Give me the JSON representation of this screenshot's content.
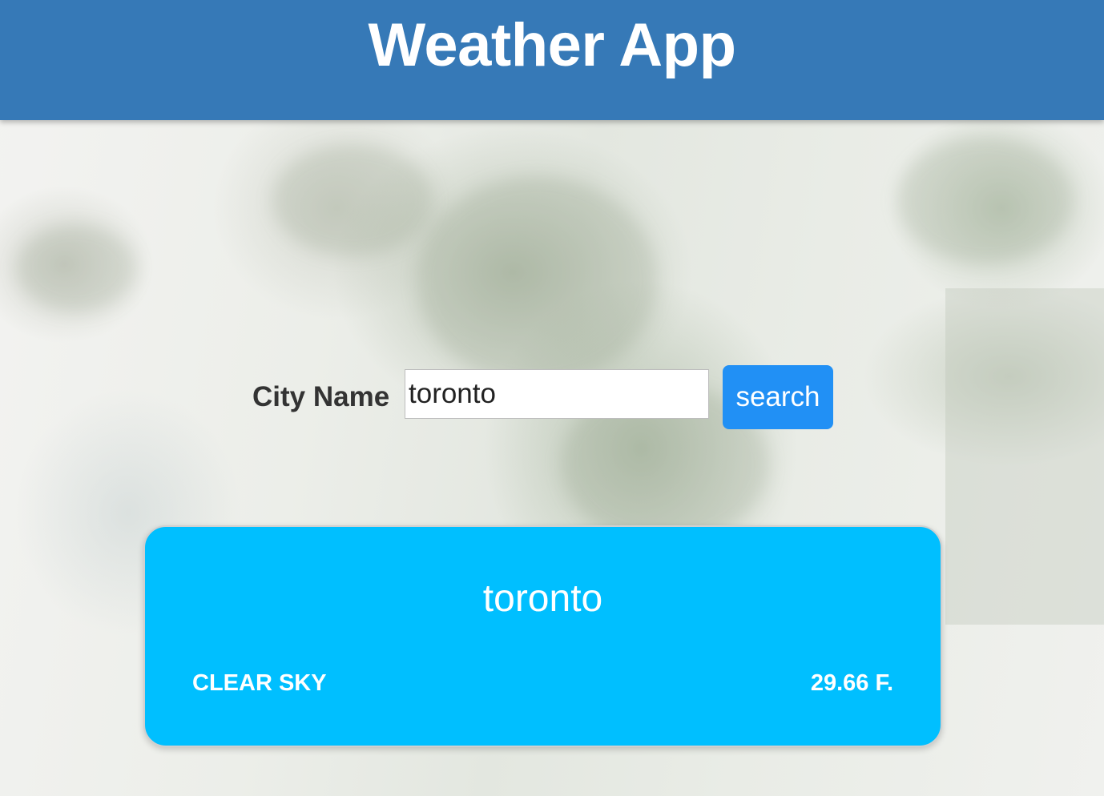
{
  "header": {
    "title": "Weather App"
  },
  "search": {
    "label": "City Name",
    "value": "toronto",
    "button_label": "search"
  },
  "result": {
    "city": "toronto",
    "description": "CLEAR SKY",
    "temperature": "29.66 F."
  },
  "colors": {
    "header_bg": "#3679b7",
    "button_bg": "#2190f5",
    "card_bg": "#00bfff",
    "label_text": "#333333"
  }
}
